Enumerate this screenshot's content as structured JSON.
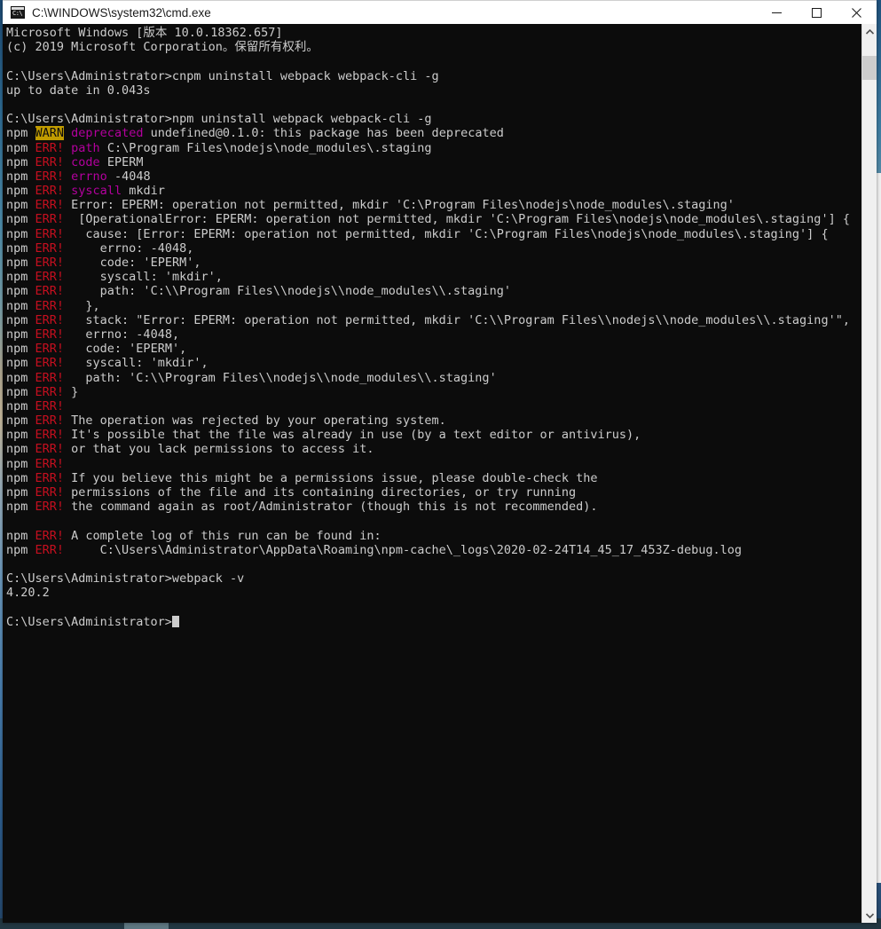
{
  "window": {
    "title": "C:\\WINDOWS\\system32\\cmd.exe",
    "icon": "cmd-console-icon",
    "controls": {
      "minimize_label": "Minimize",
      "maximize_label": "Maximize",
      "close_label": "Close"
    }
  },
  "colors": {
    "console_background": "#0c0c0c",
    "console_foreground": "#cccccc",
    "error_red": "#c50f1f",
    "keyword_magenta": "#b4009e",
    "warn_background": "#c19c00",
    "titlebar_background": "#ffffff",
    "scrollbar_track": "#f0f0f0",
    "scrollbar_thumb": "#cdcdcd"
  },
  "scrollbar": {
    "up_arrow": "chevron-up-icon",
    "down_arrow": "chevron-down-icon",
    "thumb_position_percent": 2
  },
  "console": {
    "lines": [
      [
        {
          "t": "Microsoft Windows [版本 10.0.18362.657]",
          "c": "white"
        }
      ],
      [
        {
          "t": "(c) 2019 Microsoft Corporation。保留所有权利。",
          "c": "white"
        }
      ],
      [],
      [
        {
          "t": "C:\\Users\\Administrator>cnpm uninstall webpack webpack-cli -g",
          "c": "white"
        }
      ],
      [
        {
          "t": "up to date in 0.043s",
          "c": "white"
        }
      ],
      [],
      [
        {
          "t": "C:\\Users\\Administrator>npm uninstall webpack webpack-cli -g",
          "c": "white"
        }
      ],
      [
        {
          "t": "npm ",
          "c": "white"
        },
        {
          "t": "WARN",
          "c": "warn"
        },
        {
          "t": " ",
          "c": "white"
        },
        {
          "t": "deprecated",
          "c": "magenta"
        },
        {
          "t": " undefined@0.1.0: this package has been deprecated",
          "c": "white"
        }
      ],
      [
        {
          "t": "npm ",
          "c": "white"
        },
        {
          "t": "ERR!",
          "c": "err"
        },
        {
          "t": " ",
          "c": "white"
        },
        {
          "t": "path",
          "c": "magenta"
        },
        {
          "t": " C:\\Program Files\\nodejs\\node_modules\\.staging",
          "c": "white"
        }
      ],
      [
        {
          "t": "npm ",
          "c": "white"
        },
        {
          "t": "ERR!",
          "c": "err"
        },
        {
          "t": " ",
          "c": "white"
        },
        {
          "t": "code",
          "c": "magenta"
        },
        {
          "t": " EPERM",
          "c": "white"
        }
      ],
      [
        {
          "t": "npm ",
          "c": "white"
        },
        {
          "t": "ERR!",
          "c": "err"
        },
        {
          "t": " ",
          "c": "white"
        },
        {
          "t": "errno",
          "c": "magenta"
        },
        {
          "t": " -4048",
          "c": "white"
        }
      ],
      [
        {
          "t": "npm ",
          "c": "white"
        },
        {
          "t": "ERR!",
          "c": "err"
        },
        {
          "t": " ",
          "c": "white"
        },
        {
          "t": "syscall",
          "c": "magenta"
        },
        {
          "t": " mkdir",
          "c": "white"
        }
      ],
      [
        {
          "t": "npm ",
          "c": "white"
        },
        {
          "t": "ERR!",
          "c": "err"
        },
        {
          "t": " Error: EPERM: operation not permitted, mkdir 'C:\\Program Files\\nodejs\\node_modules\\.staging'",
          "c": "white"
        }
      ],
      [
        {
          "t": "npm ",
          "c": "white"
        },
        {
          "t": "ERR!",
          "c": "err"
        },
        {
          "t": "  [OperationalError: EPERM: operation not permitted, mkdir 'C:\\Program Files\\nodejs\\node_modules\\.staging'] {",
          "c": "white"
        }
      ],
      [
        {
          "t": "npm ",
          "c": "white"
        },
        {
          "t": "ERR!",
          "c": "err"
        },
        {
          "t": "   cause: [Error: EPERM: operation not permitted, mkdir 'C:\\Program Files\\nodejs\\node_modules\\.staging'] {",
          "c": "white"
        }
      ],
      [
        {
          "t": "npm ",
          "c": "white"
        },
        {
          "t": "ERR!",
          "c": "err"
        },
        {
          "t": "     errno: -4048,",
          "c": "white"
        }
      ],
      [
        {
          "t": "npm ",
          "c": "white"
        },
        {
          "t": "ERR!",
          "c": "err"
        },
        {
          "t": "     code: 'EPERM',",
          "c": "white"
        }
      ],
      [
        {
          "t": "npm ",
          "c": "white"
        },
        {
          "t": "ERR!",
          "c": "err"
        },
        {
          "t": "     syscall: 'mkdir',",
          "c": "white"
        }
      ],
      [
        {
          "t": "npm ",
          "c": "white"
        },
        {
          "t": "ERR!",
          "c": "err"
        },
        {
          "t": "     path: 'C:\\\\Program Files\\\\nodejs\\\\node_modules\\\\.staging'",
          "c": "white"
        }
      ],
      [
        {
          "t": "npm ",
          "c": "white"
        },
        {
          "t": "ERR!",
          "c": "err"
        },
        {
          "t": "   },",
          "c": "white"
        }
      ],
      [
        {
          "t": "npm ",
          "c": "white"
        },
        {
          "t": "ERR!",
          "c": "err"
        },
        {
          "t": "   stack: \"Error: EPERM: operation not permitted, mkdir 'C:\\\\Program Files\\\\nodejs\\\\node_modules\\\\.staging'\",",
          "c": "white"
        }
      ],
      [
        {
          "t": "npm ",
          "c": "white"
        },
        {
          "t": "ERR!",
          "c": "err"
        },
        {
          "t": "   errno: -4048,",
          "c": "white"
        }
      ],
      [
        {
          "t": "npm ",
          "c": "white"
        },
        {
          "t": "ERR!",
          "c": "err"
        },
        {
          "t": "   code: 'EPERM',",
          "c": "white"
        }
      ],
      [
        {
          "t": "npm ",
          "c": "white"
        },
        {
          "t": "ERR!",
          "c": "err"
        },
        {
          "t": "   syscall: 'mkdir',",
          "c": "white"
        }
      ],
      [
        {
          "t": "npm ",
          "c": "white"
        },
        {
          "t": "ERR!",
          "c": "err"
        },
        {
          "t": "   path: 'C:\\\\Program Files\\\\nodejs\\\\node_modules\\\\.staging'",
          "c": "white"
        }
      ],
      [
        {
          "t": "npm ",
          "c": "white"
        },
        {
          "t": "ERR!",
          "c": "err"
        },
        {
          "t": " }",
          "c": "white"
        }
      ],
      [
        {
          "t": "npm ",
          "c": "white"
        },
        {
          "t": "ERR!",
          "c": "err"
        }
      ],
      [
        {
          "t": "npm ",
          "c": "white"
        },
        {
          "t": "ERR!",
          "c": "err"
        },
        {
          "t": " The operation was rejected by your operating system.",
          "c": "white"
        }
      ],
      [
        {
          "t": "npm ",
          "c": "white"
        },
        {
          "t": "ERR!",
          "c": "err"
        },
        {
          "t": " It's possible that the file was already in use (by a text editor or antivirus),",
          "c": "white"
        }
      ],
      [
        {
          "t": "npm ",
          "c": "white"
        },
        {
          "t": "ERR!",
          "c": "err"
        },
        {
          "t": " or that you lack permissions to access it.",
          "c": "white"
        }
      ],
      [
        {
          "t": "npm ",
          "c": "white"
        },
        {
          "t": "ERR!",
          "c": "err"
        }
      ],
      [
        {
          "t": "npm ",
          "c": "white"
        },
        {
          "t": "ERR!",
          "c": "err"
        },
        {
          "t": " If you believe this might be a permissions issue, please double-check the",
          "c": "white"
        }
      ],
      [
        {
          "t": "npm ",
          "c": "white"
        },
        {
          "t": "ERR!",
          "c": "err"
        },
        {
          "t": " permissions of the file and its containing directories, or try running",
          "c": "white"
        }
      ],
      [
        {
          "t": "npm ",
          "c": "white"
        },
        {
          "t": "ERR!",
          "c": "err"
        },
        {
          "t": " the command again as root/Administrator (though this is not recommended).",
          "c": "white"
        }
      ],
      [],
      [
        {
          "t": "npm ",
          "c": "white"
        },
        {
          "t": "ERR!",
          "c": "err"
        },
        {
          "t": " A complete log of this run can be found in:",
          "c": "white"
        }
      ],
      [
        {
          "t": "npm ",
          "c": "white"
        },
        {
          "t": "ERR!",
          "c": "err"
        },
        {
          "t": "     C:\\Users\\Administrator\\AppData\\Roaming\\npm-cache\\_logs\\2020-02-24T14_45_17_453Z-debug.log",
          "c": "white"
        }
      ],
      [],
      [
        {
          "t": "C:\\Users\\Administrator>webpack -v",
          "c": "white"
        }
      ],
      [
        {
          "t": "4.20.2",
          "c": "white"
        }
      ],
      [],
      [
        {
          "t": "C:\\Users\\Administrator>",
          "c": "white",
          "cursor": true
        }
      ]
    ]
  }
}
